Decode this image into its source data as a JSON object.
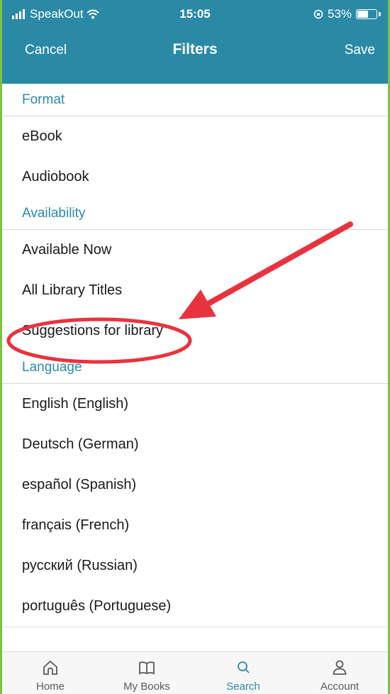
{
  "status_bar": {
    "carrier": "SpeakOut",
    "time": "15:05",
    "battery_percent": "53%",
    "battery_level": 0.53
  },
  "nav": {
    "cancel_label": "Cancel",
    "title": "Filters",
    "save_label": "Save"
  },
  "sections": [
    {
      "title": "Format",
      "options": [
        "eBook",
        "Audiobook"
      ]
    },
    {
      "title": "Availability",
      "options": [
        "Available Now",
        "All Library Titles",
        "Suggestions for library"
      ]
    },
    {
      "title": "Language",
      "options": [
        "English (English)",
        "Deutsch (German)",
        "español (Spanish)",
        "français (French)",
        "русский (Russian)",
        "português (Portuguese)"
      ]
    }
  ],
  "tab_bar": {
    "items": [
      {
        "label": "Home",
        "icon": "home-icon",
        "active": false
      },
      {
        "label": "My Books",
        "icon": "book-icon",
        "active": false
      },
      {
        "label": "Search",
        "icon": "search-icon",
        "active": true
      },
      {
        "label": "Account",
        "icon": "account-icon",
        "active": false
      }
    ]
  },
  "colors": {
    "header_bg": "#2a8aa6",
    "accent": "#2a8aa6",
    "annotation_red": "#e8333f",
    "frame_green": "#7fc242"
  }
}
